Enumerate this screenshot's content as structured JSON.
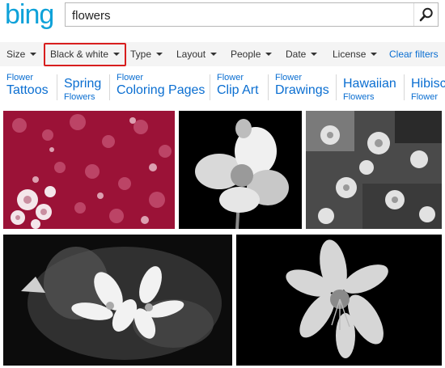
{
  "search": {
    "logo": "bing",
    "query": "flowers"
  },
  "filters": [
    {
      "label": "Size",
      "active": false
    },
    {
      "label": "Black & white",
      "active": true
    },
    {
      "label": "Type",
      "active": false
    },
    {
      "label": "Layout",
      "active": false
    },
    {
      "label": "People",
      "active": false
    },
    {
      "label": "Date",
      "active": false
    },
    {
      "label": "License",
      "active": false
    }
  ],
  "clear_filters": "Clear filters",
  "related": [
    {
      "lines": [
        "Flower",
        "Tattoos"
      ]
    },
    {
      "lines": [
        "Spring",
        "Flowers"
      ]
    },
    {
      "lines": [
        "Flower",
        "Coloring Pages"
      ]
    },
    {
      "lines": [
        "Flower",
        "Clip Art"
      ]
    },
    {
      "lines": [
        "Flower",
        "Drawings"
      ]
    },
    {
      "lines": [
        "Hawaiian",
        "Flowers"
      ]
    },
    {
      "lines": [
        "Hibisc",
        "Flower"
      ]
    }
  ],
  "images": [
    {
      "name": "pink floral pattern"
    },
    {
      "name": "white gladiolus on black"
    },
    {
      "name": "grey flower collage"
    },
    {
      "name": "white lilies on dark"
    },
    {
      "name": "white lily on black"
    }
  ],
  "colors": {
    "accent": "#0a6ed1",
    "logo": "#0fa2d9",
    "active_border": "#d81e1e",
    "filter_bg": "#f4f4f4"
  }
}
